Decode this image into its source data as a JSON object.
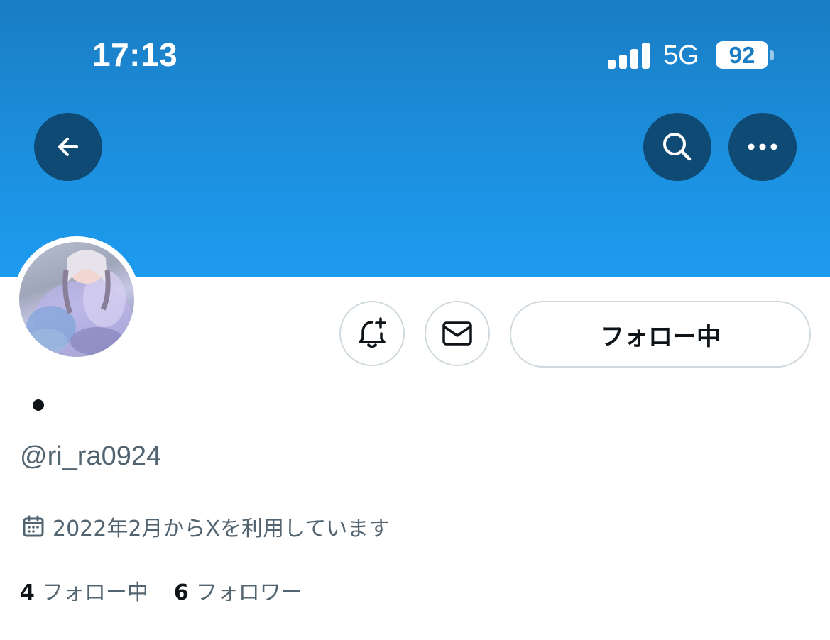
{
  "status_bar": {
    "time": "17:13",
    "network": "5G",
    "battery": "92"
  },
  "profile": {
    "display_name": "•",
    "handle": "@ri_ra0924",
    "joined": "2022年2月からXを利用しています",
    "follow_button_label": "フォロー中",
    "following_count": "4",
    "following_label": "フォロー中",
    "followers_count": "6",
    "followers_label": "フォロワー"
  },
  "icons": {
    "back": "arrow-left-icon",
    "search": "search-icon",
    "more": "more-horizontal-icon",
    "notify": "bell-plus-icon",
    "message": "envelope-icon",
    "calendar": "calendar-icon"
  },
  "colors": {
    "banner": "#1d9bf0",
    "overlay_button": "#0e4a73",
    "text_primary": "#0f1419",
    "text_secondary": "#536471",
    "border": "#cfd9de"
  }
}
